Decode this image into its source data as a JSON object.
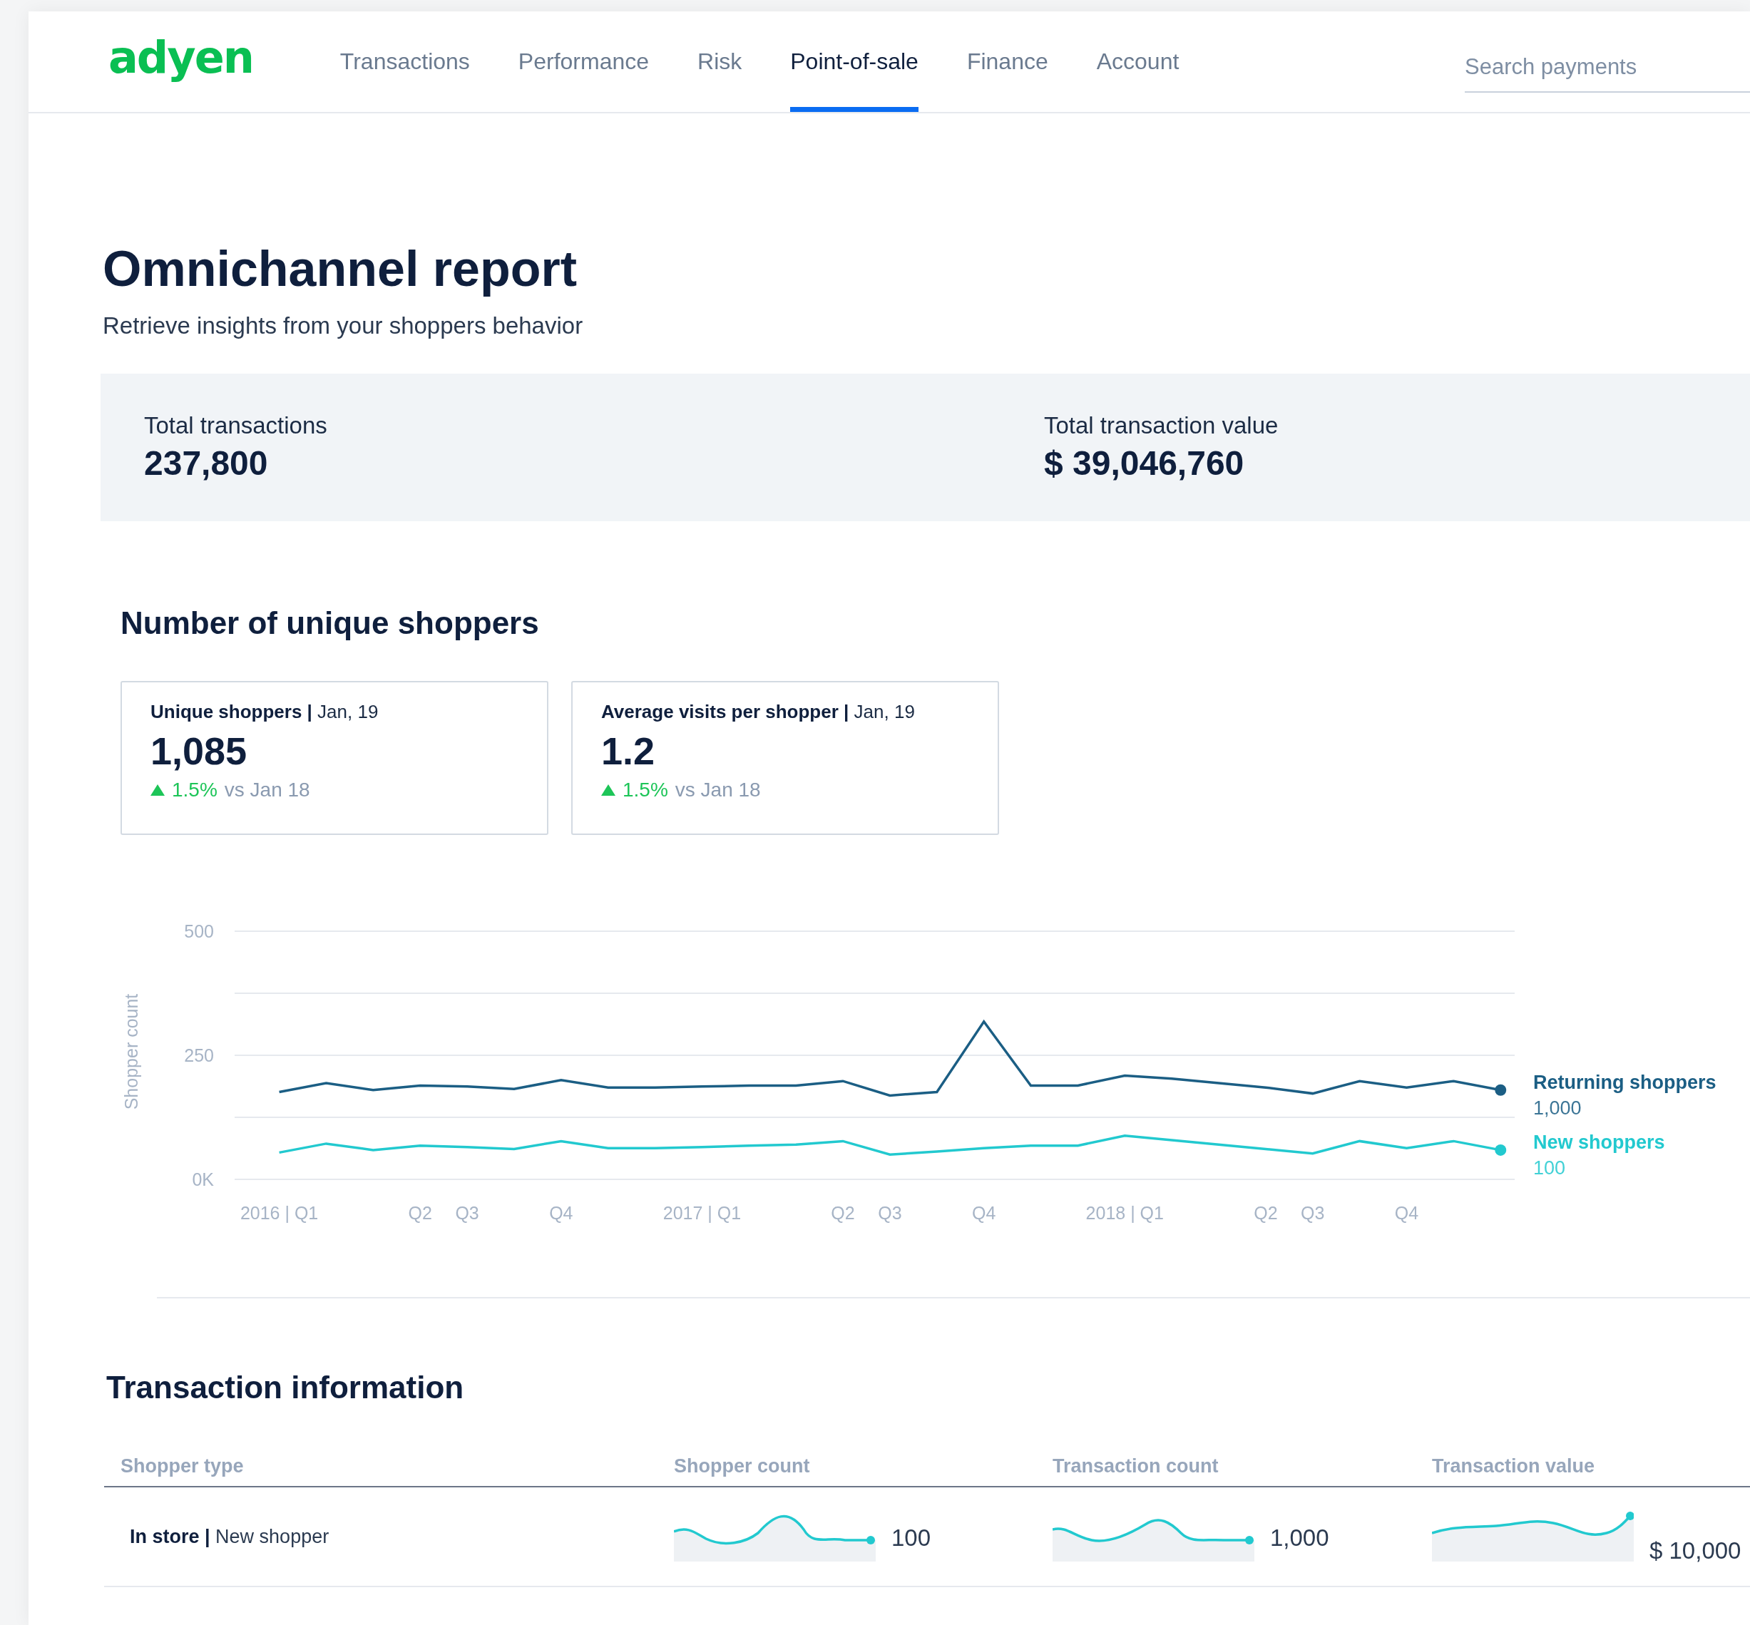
{
  "nav": {
    "logo": "adyen",
    "tabs": [
      {
        "label": "Transactions",
        "selected": false
      },
      {
        "label": "Performance",
        "selected": false
      },
      {
        "label": "Risk",
        "selected": false
      },
      {
        "label": "Point-of-sale",
        "selected": true
      },
      {
        "label": "Finance",
        "selected": false
      },
      {
        "label": "Account",
        "selected": false
      }
    ],
    "search": {
      "placeholder": "Search payments"
    }
  },
  "page": {
    "title": "Omnichannel report",
    "subtitle": "Retrieve insights from your shoppers behavior"
  },
  "summary": [
    {
      "label": "Total transactions",
      "value": "237,800"
    },
    {
      "label": "Total transaction value",
      "value": "$ 39,046,760"
    }
  ],
  "shoppers": {
    "heading": "Number of unique shoppers",
    "cards": [
      {
        "title": "**Unique shoppers |** Jan, 19",
        "value": "1,085",
        "increase": true,
        "change": "1.5%",
        "comparison": "vs Jan 18"
      },
      {
        "title": "**Average visits per shopper |** Jan, 19",
        "value": "1.2",
        "increase": true,
        "change": "1.5%",
        "comparison": "vs Jan 18"
      }
    ],
    "legend_values": [
      "1,000",
      "100"
    ],
    "chart_data": {
      "type": "line",
      "ylabel": "Shopper count",
      "categories": [
        "2016 | Q1",
        null,
        null,
        "Q2",
        "Q3",
        null,
        "Q4",
        null,
        null,
        "2017 | Q1",
        null,
        null,
        "Q2",
        "Q3",
        null,
        "Q4",
        null,
        null,
        "2018 | Q1",
        null,
        null,
        "Q2",
        "Q3",
        null,
        "Q4",
        null,
        null
      ],
      "series": [
        {
          "name": "Returning shoppers",
          "color": "#1b5e84",
          "values": [
            176,
            194,
            180,
            189,
            187,
            182,
            200,
            185,
            185,
            187,
            189,
            189,
            198,
            169,
            176,
            318,
            189,
            189,
            209,
            203,
            194,
            185,
            173,
            198,
            185,
            198,
            180
          ]
        },
        {
          "name": "New shoppers",
          "color": "#22c9cf",
          "values": [
            54,
            72,
            59,
            68,
            65,
            61,
            77,
            63,
            63,
            65,
            68,
            70,
            77,
            50,
            56,
            63,
            68,
            68,
            88,
            79,
            70,
            61,
            52,
            77,
            63,
            77,
            59
          ]
        }
      ],
      "ylim": [
        0,
        500
      ],
      "yticks": [
        {
          "value": 0,
          "label": "0K"
        },
        250,
        500
      ]
    }
  },
  "transactions": {
    "heading": "Transaction information",
    "columns": [
      "Shopper type",
      "Shopper count",
      "Transaction count",
      "Transaction value"
    ],
    "rows": [
      {
        "shopper_type": "**In store |** New shopper",
        "shopper_count": "100",
        "transaction_count": "1,000",
        "transaction_value": "$ 10,000"
      }
    ]
  }
}
